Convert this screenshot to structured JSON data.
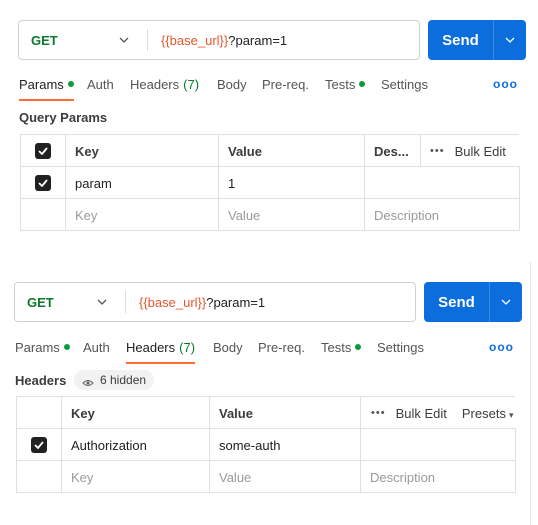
{
  "panels": [
    {
      "request": {
        "method": "GET",
        "url_var": "{{base_url}}",
        "url_rest": "?param=1",
        "send_label": "Send"
      },
      "tabs": {
        "params": "Params",
        "auth": "Auth",
        "headers": "Headers",
        "headers_count": "(7)",
        "body": "Body",
        "prereq": "Pre-req.",
        "tests": "Tests",
        "settings": "Settings",
        "more": "ooo"
      },
      "section_title": "Query Params",
      "table": {
        "headers": {
          "key": "Key",
          "value": "Value",
          "description": "Des...",
          "bulk_edit": "Bulk Edit",
          "ellipsis": "•••"
        },
        "row": {
          "key": "param",
          "value": "1",
          "description": "",
          "checked": true
        },
        "placeholder": {
          "key": "Key",
          "value": "Value",
          "description": "Description"
        }
      }
    },
    {
      "request": {
        "method": "GET",
        "url_var": "{{base_url}}",
        "url_rest": "?param=1",
        "send_label": "Send"
      },
      "tabs": {
        "params": "Params",
        "auth": "Auth",
        "headers": "Headers",
        "headers_count": "(7)",
        "body": "Body",
        "prereq": "Pre-req.",
        "tests": "Tests",
        "settings": "Settings",
        "more": "ooo"
      },
      "section_title": "Headers",
      "hidden_pill": "6 hidden",
      "table": {
        "headers": {
          "key": "Key",
          "value": "Value",
          "bulk_edit": "Bulk Edit",
          "presets": "Presets",
          "ellipsis": "•••"
        },
        "row": {
          "key": "Authorization",
          "value": "some-auth",
          "description": "",
          "checked": true
        },
        "placeholder": {
          "key": "Key",
          "value": "Value",
          "description": "Description"
        }
      }
    }
  ],
  "colors": {
    "accent_blue": "#0c6ddc",
    "method_green": "#0b7a2b",
    "variable_orange": "#e4572e",
    "tab_underline": "#ff6c37",
    "status_dot_green": "#0b9d3d"
  }
}
